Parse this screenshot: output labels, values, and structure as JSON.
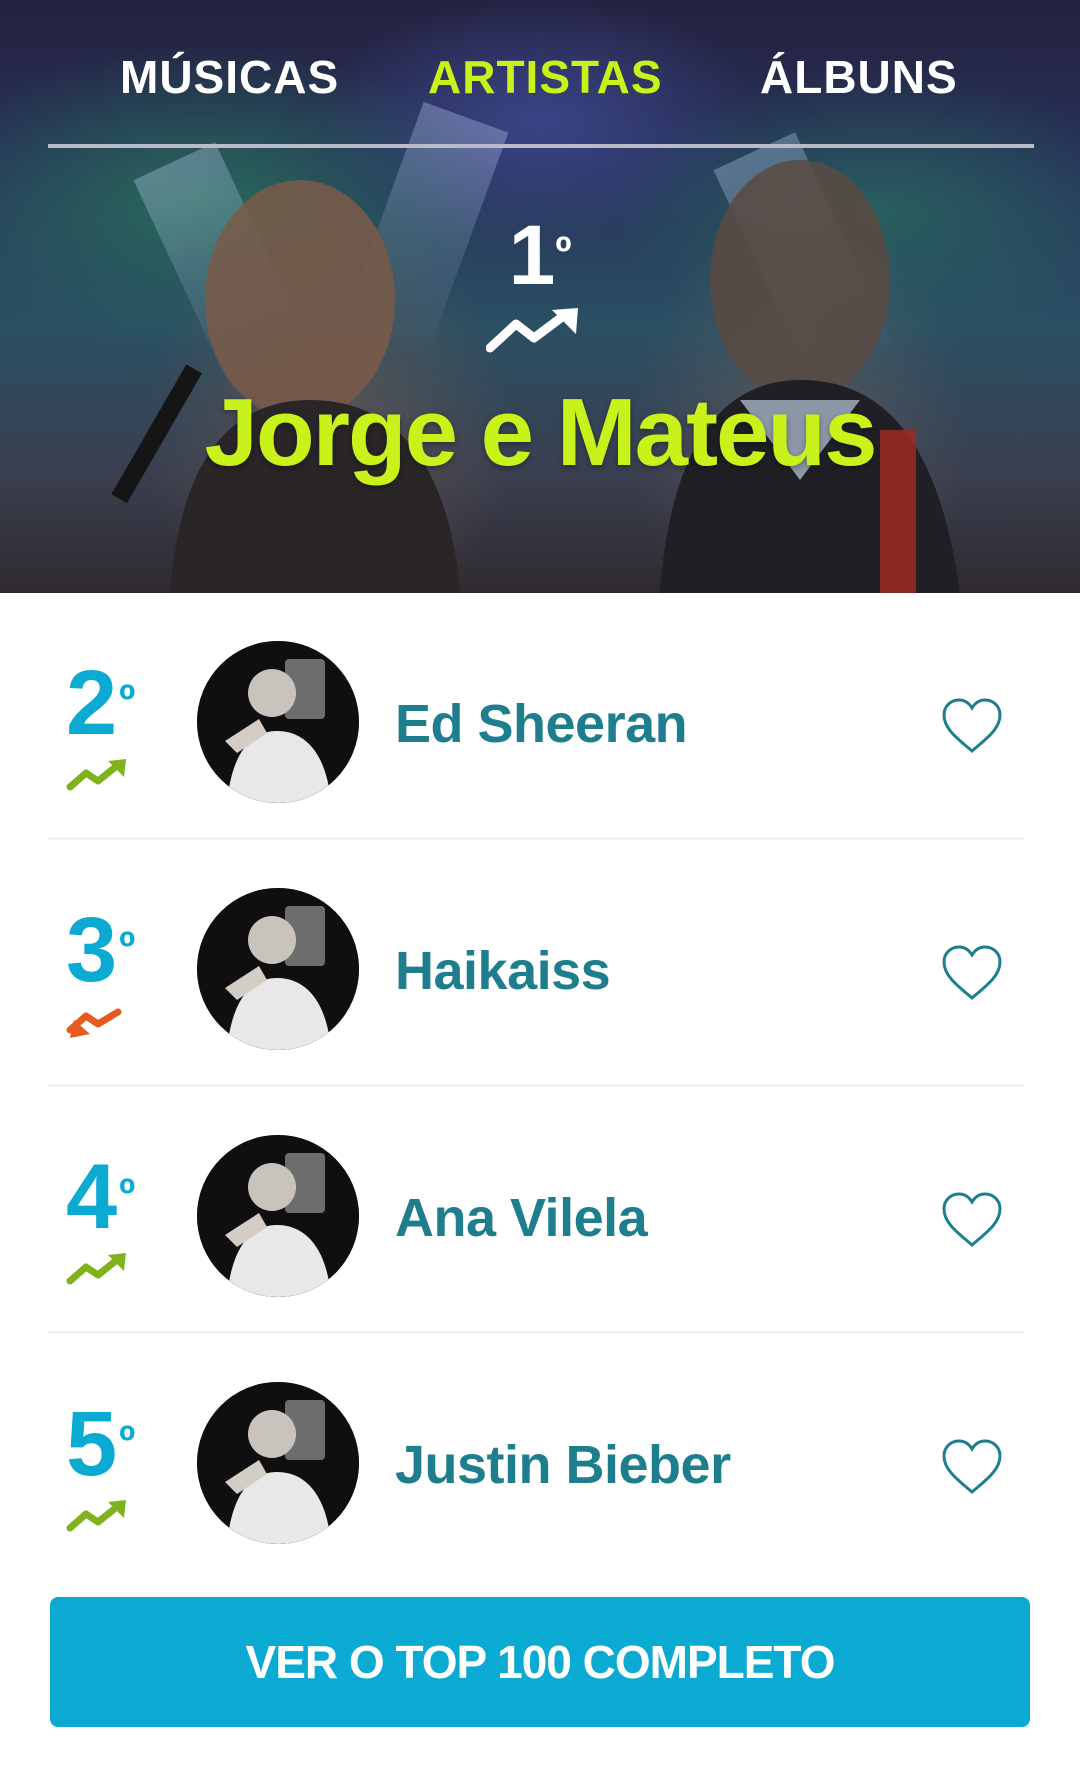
{
  "tabs": [
    {
      "label": "MÚSICAS",
      "active": false
    },
    {
      "label": "ARTISTAS",
      "active": true
    },
    {
      "label": "ÁLBUNS",
      "active": false
    }
  ],
  "featured": {
    "rank": "1",
    "rank_suffix": "º",
    "trend": "up",
    "name": "Jorge e Mateus"
  },
  "list": [
    {
      "rank": "2",
      "rank_suffix": "º",
      "trend": "up",
      "name": "Ed Sheeran",
      "favorite_icon": "heart-outline-icon"
    },
    {
      "rank": "3",
      "rank_suffix": "º",
      "trend": "down",
      "name": "Haikaiss",
      "favorite_icon": "heart-outline-icon"
    },
    {
      "rank": "4",
      "rank_suffix": "º",
      "trend": "up",
      "name": "Ana Vilela",
      "favorite_icon": "heart-outline-icon"
    },
    {
      "rank": "5",
      "rank_suffix": "º",
      "trend": "up",
      "name": "Justin Bieber",
      "favorite_icon": "heart-outline-icon"
    }
  ],
  "cta": {
    "label": "VER O TOP 100 COMPLETO"
  },
  "colors": {
    "accent_lime": "#c8f21a",
    "accent_cyan": "#0aaad2",
    "artist_teal": "#1e7e8d",
    "trend_up": "#7fb21b",
    "trend_down": "#e65a1e"
  }
}
